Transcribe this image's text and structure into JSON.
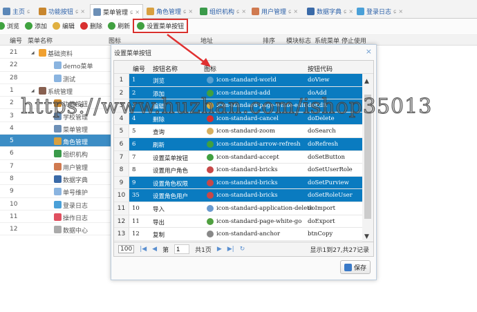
{
  "tabs": [
    {
      "label": "主页",
      "color": "#5b87b8"
    },
    {
      "label": "功能按钮",
      "color": "#c8862e"
    },
    {
      "label": "菜单管理",
      "color": "#6c8fb6"
    },
    {
      "label": "角色管理",
      "color": "#d8a040"
    },
    {
      "label": "组织机构",
      "color": "#3a9a4a"
    },
    {
      "label": "用户管理",
      "color": "#d07a50"
    },
    {
      "label": "数据字典",
      "color": "#3a6aa8"
    },
    {
      "label": "登录日志",
      "color": "#4aa0d8"
    }
  ],
  "tab_close": "×",
  "tab_refresh": "ɕ",
  "toolbar": [
    {
      "label": "浏览",
      "color": "#3fa23f"
    },
    {
      "label": "添加",
      "color": "#3fa23f"
    },
    {
      "label": "编辑",
      "color": "#e0b040"
    },
    {
      "label": "删除",
      "color": "#d83030"
    },
    {
      "label": "刷新",
      "color": "#40a040"
    },
    {
      "label": "设置菜单按钮",
      "color": "#40a040"
    }
  ],
  "main_grid": {
    "headers": [
      "编号",
      "菜单名称",
      "图标",
      "地址",
      "排序",
      "模块标志",
      "系统菜单",
      "停止使用"
    ],
    "rows": [
      {
        "rn": "1",
        "id": "21",
        "name": "基础资料",
        "level": 1,
        "expanded": true,
        "color": "#f0a030"
      },
      {
        "rn": "2",
        "id": "22",
        "name": "demo菜单",
        "level": 2,
        "color": "#8ab4e0"
      },
      {
        "rn": "3",
        "id": "28",
        "name": "测试",
        "level": 2,
        "color": "#8ab4e0"
      },
      {
        "rn": "4",
        "id": "1",
        "name": "系统管理",
        "level": 1,
        "expanded": true,
        "color": "#886050"
      },
      {
        "rn": "5",
        "id": "2",
        "name": "功能按钮",
        "level": 2,
        "color": "#c8862e"
      },
      {
        "rn": "6",
        "id": "3",
        "name": "学校管理",
        "level": 2,
        "color": "#6c8fb6"
      },
      {
        "rn": "7",
        "id": "4",
        "name": "菜单管理",
        "level": 2,
        "color": "#6c8fb6"
      },
      {
        "rn": "8",
        "id": "5",
        "name": "角色管理",
        "level": 2,
        "color": "#d8a040",
        "selected": true
      },
      {
        "rn": "9",
        "id": "6",
        "name": "组织机构",
        "level": 2,
        "color": "#3a9a4a"
      },
      {
        "rn": "10",
        "id": "7",
        "name": "用户管理",
        "level": 2,
        "color": "#d07a50"
      },
      {
        "rn": "11",
        "id": "8",
        "name": "数据字典",
        "level": 2,
        "color": "#3a6aa8"
      },
      {
        "rn": "12",
        "id": "9",
        "name": "单号维护",
        "level": 2,
        "color": "#8ab4e0"
      },
      {
        "rn": "13",
        "id": "10",
        "name": "登录日志",
        "level": 2,
        "color": "#4aa0d8"
      },
      {
        "rn": "14",
        "id": "11",
        "name": "操作日志",
        "level": 2,
        "color": "#e05060"
      },
      {
        "rn": "15",
        "id": "12",
        "name": "数据中心",
        "level": 2,
        "color": "#aaaaaa"
      }
    ]
  },
  "dialog": {
    "title": "设置菜单按钮",
    "close": "×",
    "headers": [
      "编号",
      "按钮名称",
      "图标",
      "按钮代码"
    ],
    "rows": [
      {
        "rn": "1",
        "id": "1",
        "name": "浏览",
        "icon": "icon-standard-world",
        "code": "doView",
        "selected": true,
        "color": "#5aa0d0"
      },
      {
        "rn": "2",
        "id": "2",
        "name": "添加",
        "icon": "icon-standard-add",
        "code": "doAdd",
        "selected": true,
        "color": "#40a040"
      },
      {
        "rn": "3",
        "id": "3",
        "name": "编辑",
        "icon": "icon-standard-page-white-edit",
        "code": "doEdit",
        "selected": true,
        "color": "#e0b040"
      },
      {
        "rn": "4",
        "id": "4",
        "name": "删除",
        "icon": "icon-standard-cancel",
        "code": "doDelete",
        "selected": true,
        "color": "#d83030"
      },
      {
        "rn": "5",
        "id": "5",
        "name": "查询",
        "icon": "icon-standard-zoom",
        "code": "doSearch",
        "selected": false,
        "color": "#d8b060"
      },
      {
        "rn": "6",
        "id": "6",
        "name": "刷新",
        "icon": "icon-standard-arrow-refresh",
        "code": "doRefresh",
        "selected": true,
        "color": "#40a040"
      },
      {
        "rn": "7",
        "id": "7",
        "name": "设置菜单按钮",
        "icon": "icon-standard-accept",
        "code": "doSetButton",
        "selected": false,
        "color": "#40a040"
      },
      {
        "rn": "8",
        "id": "8",
        "name": "设置用户角色",
        "icon": "icon-standard-bricks",
        "code": "doSetUserRole",
        "selected": false,
        "color": "#c84848"
      },
      {
        "rn": "9",
        "id": "9",
        "name": "设置角色权限",
        "icon": "icon-standard-bricks",
        "code": "doSetPurview",
        "selected": true,
        "color": "#c84848"
      },
      {
        "rn": "10",
        "id": "35",
        "name": "设置角色用户",
        "icon": "icon-standard-bricks",
        "code": "doSetRoleUser",
        "selected": true,
        "color": "#c84848"
      },
      {
        "rn": "11",
        "id": "10",
        "name": "导入",
        "icon": "icon-standard-application-delete",
        "code": "doImport",
        "selected": false,
        "color": "#6a9bd0"
      },
      {
        "rn": "12",
        "id": "11",
        "name": "导出",
        "icon": "icon-standard-page-white-go",
        "code": "doExport",
        "selected": false,
        "color": "#50a040"
      },
      {
        "rn": "13",
        "id": "12",
        "name": "复制",
        "icon": "icon-standard-anchor",
        "code": "btnCopy",
        "selected": false,
        "color": "#888888"
      }
    ],
    "pager": {
      "page_size": "100",
      "page_prefix": "第",
      "page": "1",
      "page_suffix": "共1页",
      "info": "显示1到27,共27记录"
    },
    "save_label": "保存"
  },
  "watermark": "https://www.huzhan.com/ishop35013"
}
